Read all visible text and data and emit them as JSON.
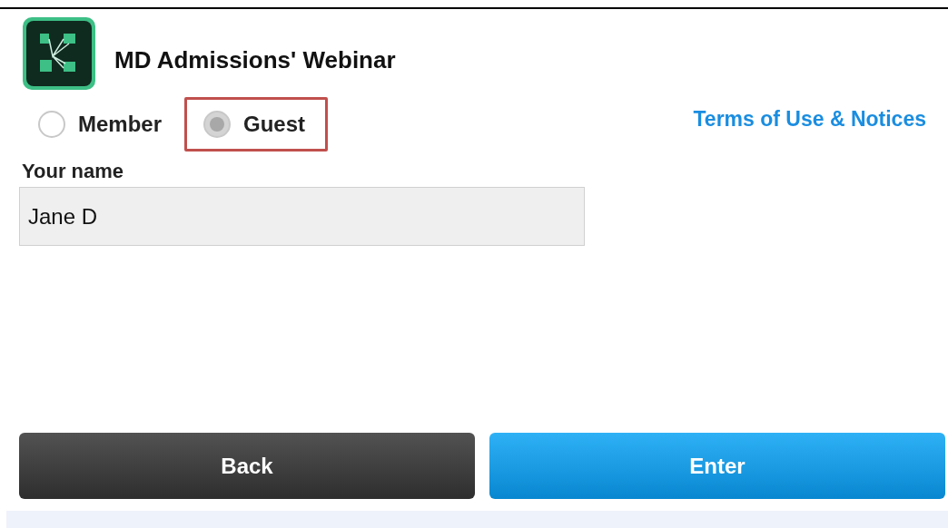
{
  "title": "MD Admissions' Webinar",
  "login_options": [
    {
      "label": "Member",
      "selected": false,
      "highlighted": false
    },
    {
      "label": "Guest",
      "selected": true,
      "highlighted": true
    }
  ],
  "terms_link": "Terms of Use & Notices",
  "name_field": {
    "label": "Your name",
    "value": "Jane D"
  },
  "buttons": [
    {
      "label": "Back",
      "kind": "secondary"
    },
    {
      "label": "Enter",
      "kind": "primary"
    }
  ]
}
